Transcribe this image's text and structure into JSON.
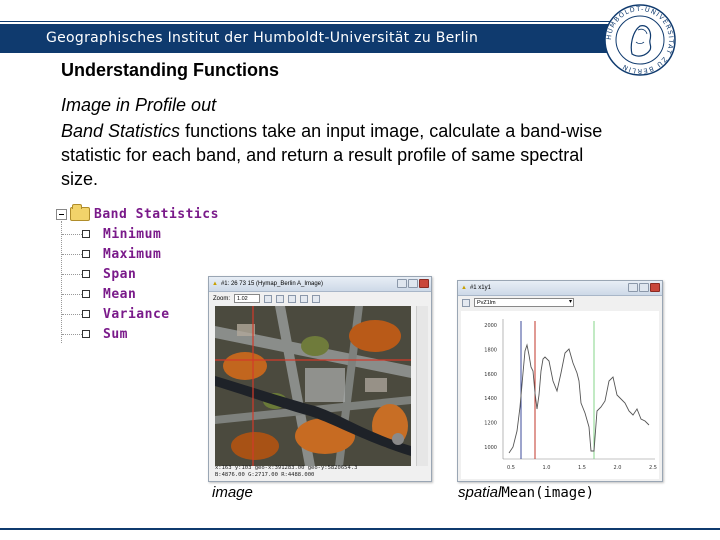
{
  "header": {
    "title": "Geographisches Institut der Humboldt-Universität zu Berlin",
    "seal_text": "HUMBOLDT-UNIVERSITÄT ZU BERLIN",
    "brand_color": "#0f3a6e"
  },
  "slide": {
    "heading": "Understanding Functions",
    "subheading": "Image in Profile out",
    "body_emphasis": "Band Statistics",
    "body_rest": " functions take an input image, calculate a band-wise statistic for each band, and return a result profile of same spectral size."
  },
  "tree": {
    "root_label": "Band Statistics",
    "items": [
      {
        "label": "Minimum"
      },
      {
        "label": "Maximum"
      },
      {
        "label": "Span"
      },
      {
        "label": "Mean"
      },
      {
        "label": "Variance"
      },
      {
        "label": "Sum"
      }
    ],
    "label_color": "#7a1a8a"
  },
  "image_window": {
    "title": "#1: 26 73 15 (Hymap_Berlin A_Image)",
    "zoom_label": "Zoom:",
    "zoom_value": "1.02",
    "status_line1": "x:163 y:103 geo-x:391283.00 geo-y:5820654.3",
    "status_line2": "B:4876.00 G:2717.00 R:4488.000"
  },
  "profile_window": {
    "title": "#1 x1y1",
    "select_value": "PvZ1lm",
    "y_ticks": [
      "2000",
      "1800",
      "1600",
      "1400",
      "1200",
      "1000"
    ],
    "x_ticks": [
      "0.5",
      "1.0",
      "1.5",
      "2.0",
      "2.5"
    ]
  },
  "captions": {
    "left": "image",
    "right_prefix": "spatial",
    "right_mono": "Mean(image)"
  }
}
